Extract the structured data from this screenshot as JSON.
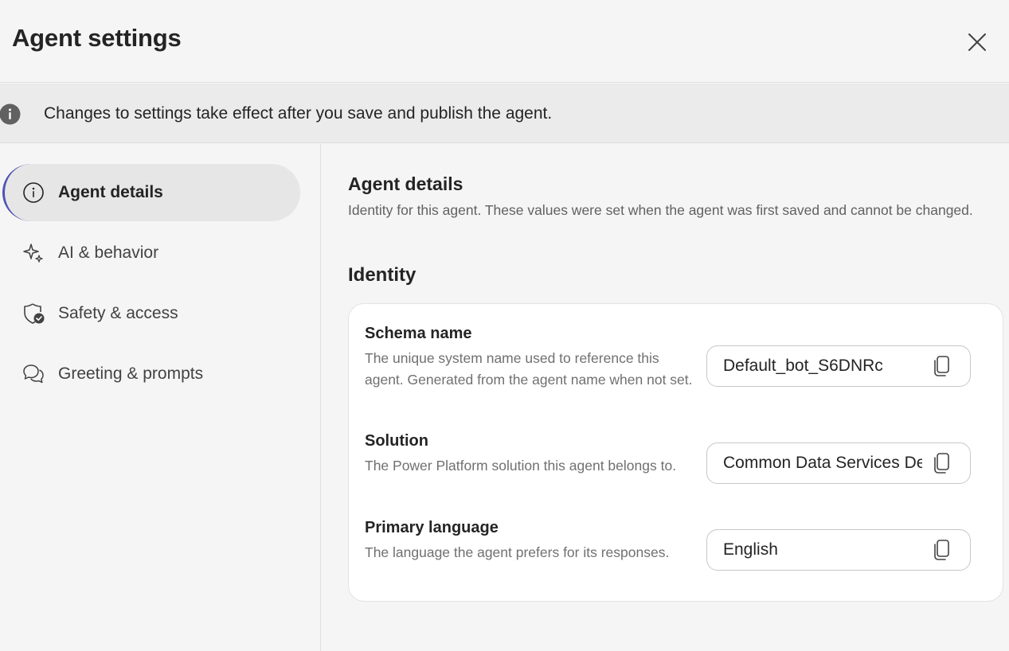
{
  "header": {
    "title": "Agent settings"
  },
  "banner": {
    "text": "Changes to settings take effect after you save and publish the agent."
  },
  "sidebar": {
    "items": [
      {
        "label": "Agent details",
        "icon": "info-icon",
        "active": true
      },
      {
        "label": "AI & behavior",
        "icon": "sparkle-icon",
        "active": false
      },
      {
        "label": "Safety & access",
        "icon": "shield-check-icon",
        "active": false
      },
      {
        "label": "Greeting & prompts",
        "icon": "chat-bubbles-icon",
        "active": false
      }
    ]
  },
  "main": {
    "title": "Agent details",
    "description": "Identity for this agent. These values were set when the agent was first saved and cannot be changed.",
    "identity": {
      "title": "Identity",
      "fields": [
        {
          "label": "Schema name",
          "description": "The unique system name used to reference this agent. Generated from the agent name when not set.",
          "value": "Default_bot_S6DNRc"
        },
        {
          "label": "Solution",
          "description": "The Power Platform solution this agent belongs to.",
          "value": "Common Data Services Default Solution"
        },
        {
          "label": "Primary language",
          "description": "The language the agent prefers for its responses.",
          "value": "English"
        }
      ]
    }
  },
  "colors": {
    "accent": "#4f52b2",
    "active_bg": "#e6e6e6",
    "banner_bg": "#ebebeb"
  }
}
